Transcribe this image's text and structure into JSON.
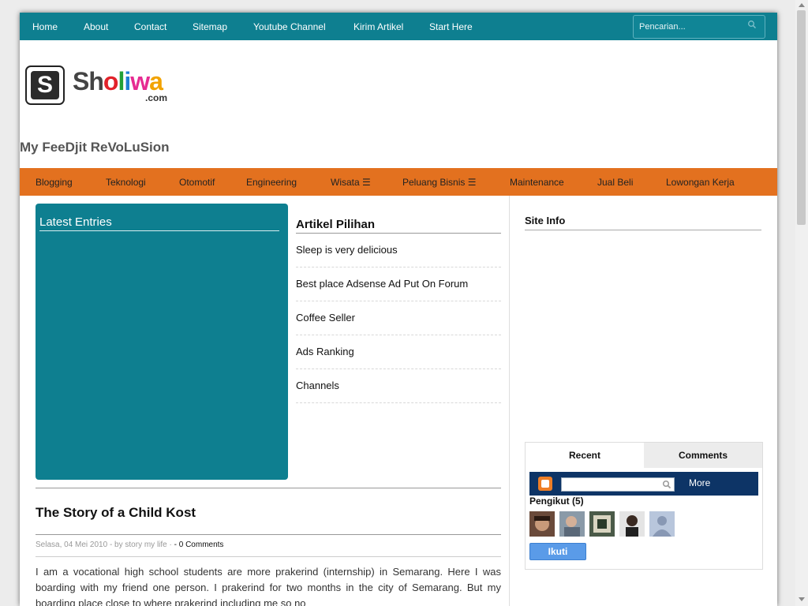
{
  "top_nav": {
    "items": [
      "Home",
      "About",
      "Contact",
      "Sitemap",
      "Youtube Channel",
      "Kirim Artikel",
      "Start Here"
    ],
    "search_placeholder": "Pencarian..."
  },
  "logo": {
    "letter": "S",
    "text_parts": [
      "Sh",
      "o",
      "l",
      "i",
      "w",
      "a"
    ],
    "text_colors": [
      "#444444",
      "#e2222a",
      "#22a037",
      "#1e7fd3",
      "#e62c92",
      "#f2a300"
    ],
    "suffix": ".com"
  },
  "blog_title": "My FeeDjit ReVoLuSion",
  "category_nav": {
    "items": [
      "Blogging",
      "Teknologi",
      "Otomotif",
      "Engineering",
      "Wisata ☰",
      "Peluang Bisnis ☰",
      "Maintenance",
      "Jual Beli",
      "Lowongan Kerja"
    ]
  },
  "latest_entries": {
    "title": "Latest Entries"
  },
  "artikel_pilihan": {
    "title": "Artikel Pilihan",
    "items": [
      "Sleep is very delicious",
      "Best place Adsense Ad Put On Forum",
      "Coffee Seller",
      "Ads Ranking",
      "Channels"
    ]
  },
  "sidebar": {
    "site_info_title": "Site Info",
    "tabs": [
      "Recent",
      "Comments"
    ],
    "followers": {
      "more_label": "More",
      "title": "Pengikut (5)",
      "follow_button": "Ikuti"
    }
  },
  "post": {
    "title": "The Story of a Child Kost",
    "meta": "Selasa, 04 Mei 2010 - by story my life ·",
    "comments": "- 0 Comments",
    "body": "I am a vocational high school students are more prakerind (internship) in Semarang. Here I was boarding with my friend one person. I prakerind for two months in the city of Semarang. But my boarding place close to where prakerind including me so no"
  },
  "colors": {
    "teal": "#0e7f90",
    "orange": "#e3711f",
    "navy": "#0d3466"
  }
}
